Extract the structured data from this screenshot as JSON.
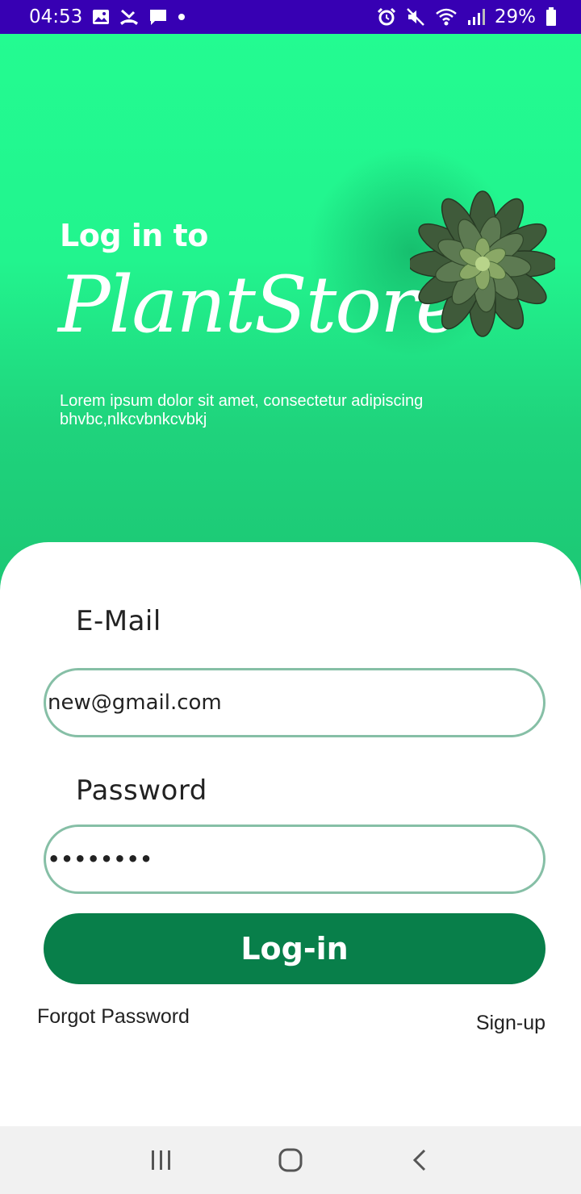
{
  "status_bar": {
    "time": "04:53",
    "battery": "29%",
    "left_icons": [
      "image-icon",
      "missed-call-icon",
      "message-icon",
      "dot-icon"
    ],
    "right_icons": [
      "alarm-icon",
      "mute-icon",
      "wifi-icon",
      "signal-icon",
      "battery-icon"
    ],
    "background": "#3700b3"
  },
  "hero": {
    "title_small": "Log in to",
    "title_large": "PlantStore",
    "description": "Lorem ipsum dolor sit amet, consectetur adipiscing bhvbc,nlkcvbnkcvbkj",
    "gradient_top": "#23fb91",
    "gradient_bottom": "#1cc774"
  },
  "form": {
    "email_label": "E-Mail",
    "email_value": "new@gmail.com",
    "password_label": "Password",
    "password_value": "••••••••",
    "login_button": "Log-in",
    "forgot_password": "Forgot Password",
    "signup": "Sign-up",
    "accent": "#087f4a",
    "input_border": "#86bfa6"
  },
  "nav_bar": {
    "buttons": [
      "recent-apps-icon",
      "home-icon",
      "back-icon"
    ]
  }
}
